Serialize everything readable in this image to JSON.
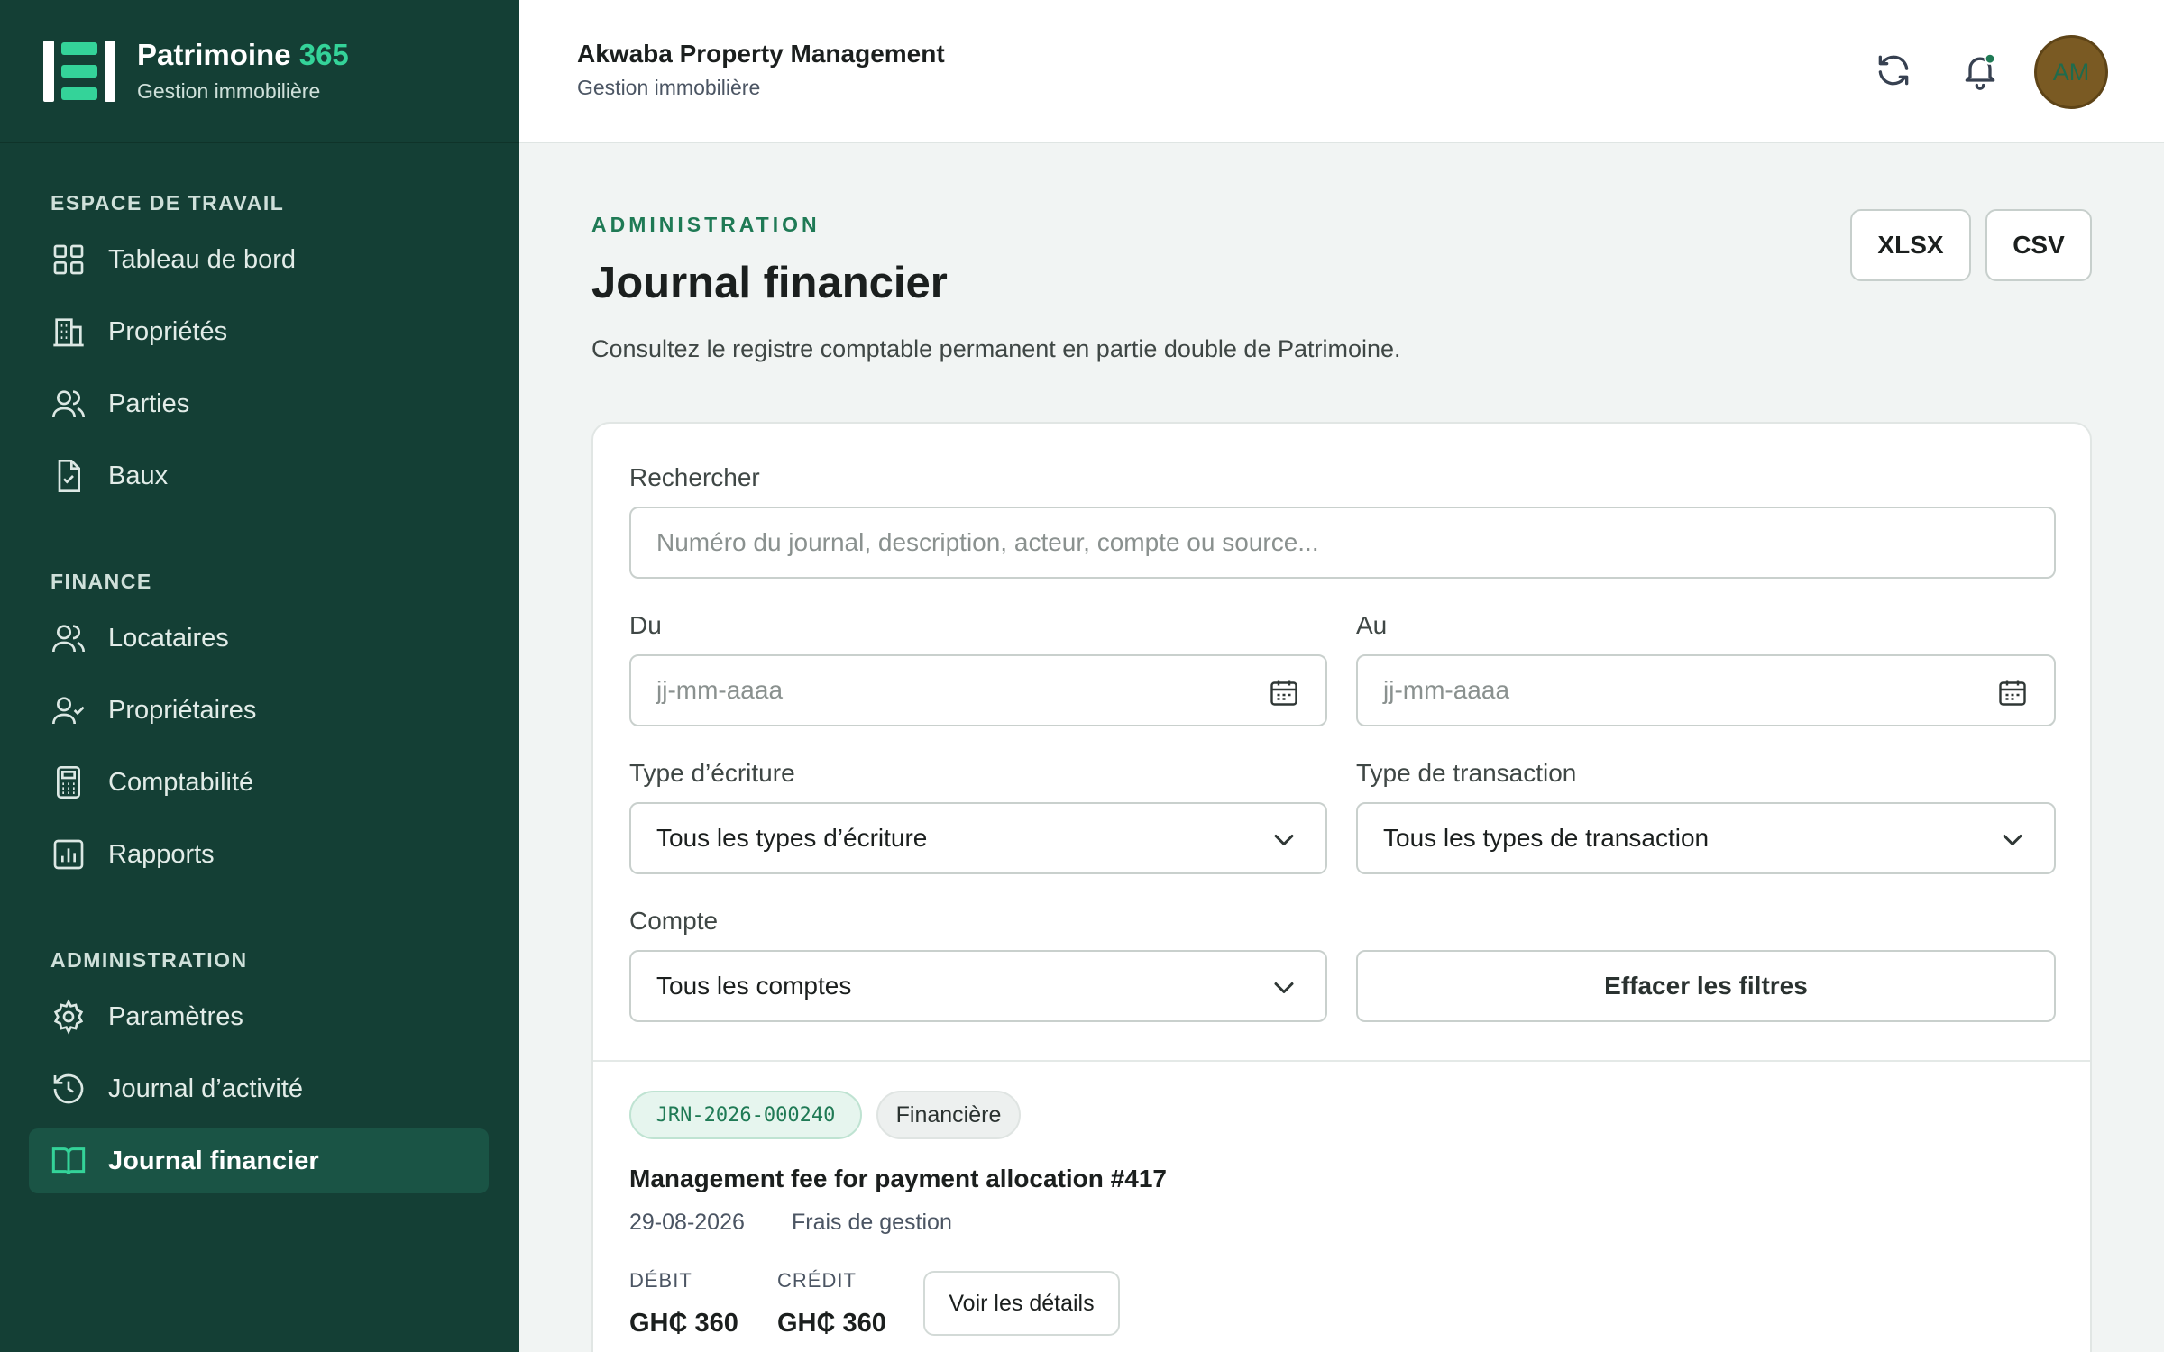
{
  "brand": {
    "name": "Patrimoine",
    "name_accent": "365",
    "subtitle": "Gestion immobilière"
  },
  "sidebar": {
    "sections": [
      {
        "title": "ESPACE DE TRAVAIL",
        "items": [
          {
            "label": "Tableau de bord",
            "icon": "dashboard-icon"
          },
          {
            "label": "Propriétés",
            "icon": "building-icon"
          },
          {
            "label": "Parties",
            "icon": "users-icon"
          },
          {
            "label": "Baux",
            "icon": "lease-document-icon"
          }
        ]
      },
      {
        "title": "FINANCE",
        "items": [
          {
            "label": "Locataires",
            "icon": "users-icon"
          },
          {
            "label": "Propriétaires",
            "icon": "user-check-icon"
          },
          {
            "label": "Comptabilité",
            "icon": "calculator-icon"
          },
          {
            "label": "Rapports",
            "icon": "report-chart-icon"
          }
        ]
      },
      {
        "title": "ADMINISTRATION",
        "items": [
          {
            "label": "Paramètres",
            "icon": "gear-icon"
          },
          {
            "label": "Journal d’activité",
            "icon": "history-icon"
          },
          {
            "label": "Journal financier",
            "icon": "book-icon",
            "active": true
          }
        ]
      }
    ]
  },
  "header": {
    "org_name": "Akwaba Property Management",
    "org_subtitle": "Gestion immobilière",
    "avatar_initials": "AM"
  },
  "page": {
    "eyebrow": "ADMINISTRATION",
    "title": "Journal financier",
    "description": "Consultez le registre comptable permanent en partie double de Patrimoine.",
    "export_xlsx": "XLSX",
    "export_csv": "CSV"
  },
  "filters": {
    "search_label": "Rechercher",
    "search_placeholder": "Numéro du journal, description, acteur, compte ou source...",
    "from_label": "Du",
    "from_placeholder": "jj-mm-aaaa",
    "to_label": "Au",
    "to_placeholder": "jj-mm-aaaa",
    "entry_type_label": "Type d’écriture",
    "entry_type_value": "Tous les types d’écriture",
    "transaction_type_label": "Type de transaction",
    "transaction_type_value": "Tous les types de transaction",
    "account_label": "Compte",
    "account_value": "Tous les comptes",
    "clear_label": "Effacer les filtres"
  },
  "entry": {
    "code": "JRN-2026-000240",
    "type": "Financière",
    "title": "Management fee for payment allocation #417",
    "date": "29-08-2026",
    "category": "Frais de gestion",
    "debit_label": "DÉBIT",
    "debit_value": "GH₵ 360",
    "credit_label": "CRÉDIT",
    "credit_value": "GH₵ 360",
    "details_label": "Voir les détails"
  },
  "colors": {
    "sidebar": "#143f35",
    "accent": "#34d399",
    "brand_green": "#1f7a55",
    "active_item": "#1a5445"
  }
}
